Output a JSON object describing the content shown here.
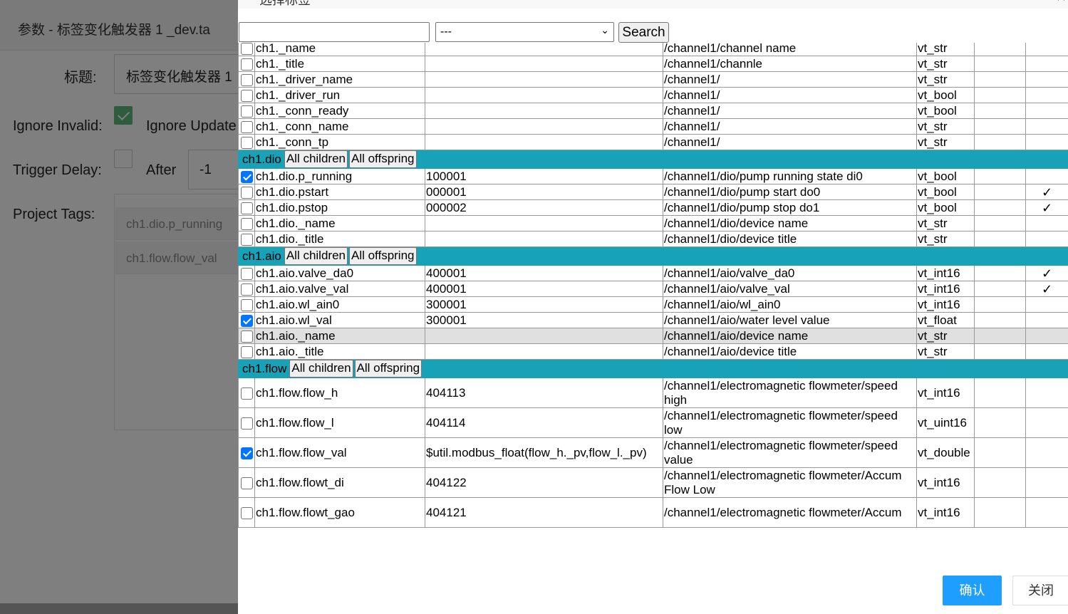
{
  "background_dialog": {
    "title": "参数 - 标签变化触发器 1   _dev.ta",
    "title_label": "标题:",
    "title_value": "标签变化触发器 1",
    "ignore_invalid_label": "Ignore Invalid:",
    "ignore_invalid_checked": true,
    "ignore_update_label": "Ignore Update",
    "trigger_delay_label": "Trigger Delay:",
    "trigger_delay_checked": false,
    "after_label": "After",
    "after_value": "-1",
    "project_tags_label": "Project Tags:",
    "project_tags": [
      "ch1.dio.p_running",
      "ch1.flow.flow_val"
    ]
  },
  "modal": {
    "title": "选择标签",
    "close_icon": "close-icon",
    "search_placeholder": "",
    "search_value": "",
    "filter_selected": "---",
    "search_label": "Search",
    "confirm_label": "确认",
    "cancel_label": "关闭",
    "group_buttons": {
      "all_children": "All children",
      "all_offspring": "All offspring"
    },
    "rows": [
      {
        "kind": "tag",
        "checked": false,
        "name": "ch1._name",
        "addr": "",
        "desc": "/channel1/channel name",
        "type": "vt_str",
        "extra": "",
        "mark": ""
      },
      {
        "kind": "tag",
        "checked": false,
        "name": "ch1._title",
        "addr": "",
        "desc": "/channel1/channle",
        "type": "vt_str",
        "extra": "",
        "mark": ""
      },
      {
        "kind": "tag",
        "checked": false,
        "name": "ch1._driver_name",
        "addr": "",
        "desc": "/channel1/",
        "type": "vt_str",
        "extra": "",
        "mark": ""
      },
      {
        "kind": "tag",
        "checked": false,
        "name": "ch1._driver_run",
        "addr": "",
        "desc": "/channel1/",
        "type": "vt_bool",
        "extra": "",
        "mark": ""
      },
      {
        "kind": "tag",
        "checked": false,
        "name": "ch1._conn_ready",
        "addr": "",
        "desc": "/channel1/",
        "type": "vt_bool",
        "extra": "",
        "mark": ""
      },
      {
        "kind": "tag",
        "checked": false,
        "name": "ch1._conn_name",
        "addr": "",
        "desc": "/channel1/",
        "type": "vt_str",
        "extra": "",
        "mark": ""
      },
      {
        "kind": "tag",
        "checked": false,
        "name": "ch1._conn_tp",
        "addr": "",
        "desc": "/channel1/",
        "type": "vt_str",
        "extra": "",
        "mark": ""
      },
      {
        "kind": "group",
        "name": "ch1.dio"
      },
      {
        "kind": "tag",
        "checked": true,
        "name": "ch1.dio.p_running",
        "addr": "100001",
        "desc": "/channel1/dio/pump running state di0",
        "type": "vt_bool",
        "extra": "",
        "mark": ""
      },
      {
        "kind": "tag",
        "checked": false,
        "name": "ch1.dio.pstart",
        "addr": "000001",
        "desc": "/channel1/dio/pump start do0",
        "type": "vt_bool",
        "extra": "",
        "mark": "✓"
      },
      {
        "kind": "tag",
        "checked": false,
        "name": "ch1.dio.pstop",
        "addr": "000002",
        "desc": "/channel1/dio/pump stop do1",
        "type": "vt_bool",
        "extra": "",
        "mark": "✓"
      },
      {
        "kind": "tag",
        "checked": false,
        "name": "ch1.dio._name",
        "addr": "",
        "desc": "/channel1/dio/device name",
        "type": "vt_str",
        "extra": "",
        "mark": ""
      },
      {
        "kind": "tag",
        "checked": false,
        "name": "ch1.dio._title",
        "addr": "",
        "desc": "/channel1/dio/device title",
        "type": "vt_str",
        "extra": "",
        "mark": ""
      },
      {
        "kind": "group",
        "name": "ch1.aio"
      },
      {
        "kind": "tag",
        "checked": false,
        "name": "ch1.aio.valve_da0",
        "addr": "400001",
        "desc": "/channel1/aio/valve_da0",
        "type": "vt_int16",
        "extra": "",
        "mark": "✓"
      },
      {
        "kind": "tag",
        "checked": false,
        "name": "ch1.aio.valve_val",
        "addr": "400001",
        "desc": "/channel1/aio/valve_val",
        "type": "vt_int16",
        "extra": "",
        "mark": "✓"
      },
      {
        "kind": "tag",
        "checked": false,
        "name": "ch1.aio.wl_ain0",
        "addr": "300001",
        "desc": "/channel1/aio/wl_ain0",
        "type": "vt_int16",
        "extra": "",
        "mark": ""
      },
      {
        "kind": "tag",
        "checked": true,
        "name": "ch1.aio.wl_val",
        "addr": "300001",
        "desc": "/channel1/aio/water level value",
        "type": "vt_float",
        "extra": "",
        "mark": ""
      },
      {
        "kind": "tag",
        "checked": false,
        "name": "ch1.aio._name",
        "addr": "",
        "desc": "/channel1/aio/device name",
        "type": "vt_str",
        "extra": "",
        "mark": "",
        "highlighted": true
      },
      {
        "kind": "tag",
        "checked": false,
        "name": "ch1.aio._title",
        "addr": "",
        "desc": "/channel1/aio/device title",
        "type": "vt_str",
        "extra": "",
        "mark": ""
      },
      {
        "kind": "group",
        "name": "ch1.flow"
      },
      {
        "kind": "tag",
        "tall": true,
        "checked": false,
        "name": "ch1.flow.flow_h",
        "addr": "404113",
        "desc": "/channel1/electromagnetic flowmeter/speed high",
        "type": "vt_int16",
        "extra": "",
        "mark": ""
      },
      {
        "kind": "tag",
        "tall": true,
        "checked": false,
        "name": "ch1.flow.flow_l",
        "addr": "404114",
        "desc": "/channel1/electromagnetic flowmeter/speed low",
        "type": "vt_uint16",
        "extra": "",
        "mark": ""
      },
      {
        "kind": "tag",
        "tall": true,
        "checked": true,
        "name": "ch1.flow.flow_val",
        "addr": "$util.modbus_float(flow_h._pv,flow_l._pv)",
        "desc": "/channel1/electromagnetic flowmeter/speed value",
        "type": "vt_double",
        "extra": "",
        "mark": ""
      },
      {
        "kind": "tag",
        "tall": true,
        "checked": false,
        "name": "ch1.flow.flowt_di",
        "addr": "404122",
        "desc": "/channel1/electromagnetic flowmeter/Accum Flow Low",
        "type": "vt_int16",
        "extra": "",
        "mark": ""
      },
      {
        "kind": "tag",
        "tall": true,
        "checked": false,
        "name": "ch1.flow.flowt_gao",
        "addr": "404121",
        "desc": "/channel1/electromagnetic flowmeter/Accum",
        "type": "vt_int16",
        "extra": "",
        "mark": ""
      }
    ]
  }
}
